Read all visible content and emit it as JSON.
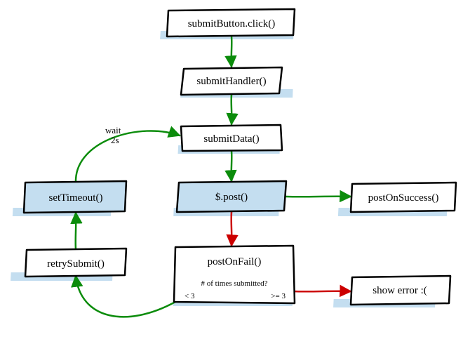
{
  "chart_data": {
    "type": "flowchart",
    "title": "",
    "nodes": [
      {
        "id": "click",
        "label": "submitButton.click()",
        "fill": "#ffffff"
      },
      {
        "id": "handler",
        "label": "submitHandler()",
        "fill": "#ffffff"
      },
      {
        "id": "submitData",
        "label": "submitData()",
        "fill": "#ffffff"
      },
      {
        "id": "post",
        "label": "$.post()",
        "fill": "#c4def0"
      },
      {
        "id": "success",
        "label": "postOnSuccess()",
        "fill": "#ffffff"
      },
      {
        "id": "fail",
        "label": "postOnFail()",
        "fill": "#ffffff",
        "sub": "# of times submitted?",
        "branches": {
          "left": "< 3",
          "right": ">= 3"
        }
      },
      {
        "id": "showError",
        "label": "show error :(",
        "fill": "#ffffff"
      },
      {
        "id": "retry",
        "label": "retrySubmit()",
        "fill": "#ffffff"
      },
      {
        "id": "timeout",
        "label": "setTimeout()",
        "fill": "#c4def0"
      }
    ],
    "edges": [
      {
        "from": "click",
        "to": "handler",
        "color": "green"
      },
      {
        "from": "handler",
        "to": "submitData",
        "color": "green"
      },
      {
        "from": "submitData",
        "to": "post",
        "color": "green"
      },
      {
        "from": "post",
        "to": "success",
        "color": "green"
      },
      {
        "from": "post",
        "to": "fail",
        "color": "red"
      },
      {
        "from": "fail",
        "to": "showError",
        "color": "red",
        "condition": ">= 3"
      },
      {
        "from": "fail",
        "to": "retry",
        "color": "green",
        "condition": "< 3"
      },
      {
        "from": "retry",
        "to": "timeout",
        "color": "green"
      },
      {
        "from": "timeout",
        "to": "submitData",
        "color": "green",
        "label": "wait\n2s"
      }
    ],
    "colors": {
      "green": "#0b8c0b",
      "red": "#cc0000",
      "highlight": "#c4def0",
      "stroke": "#000000"
    }
  }
}
